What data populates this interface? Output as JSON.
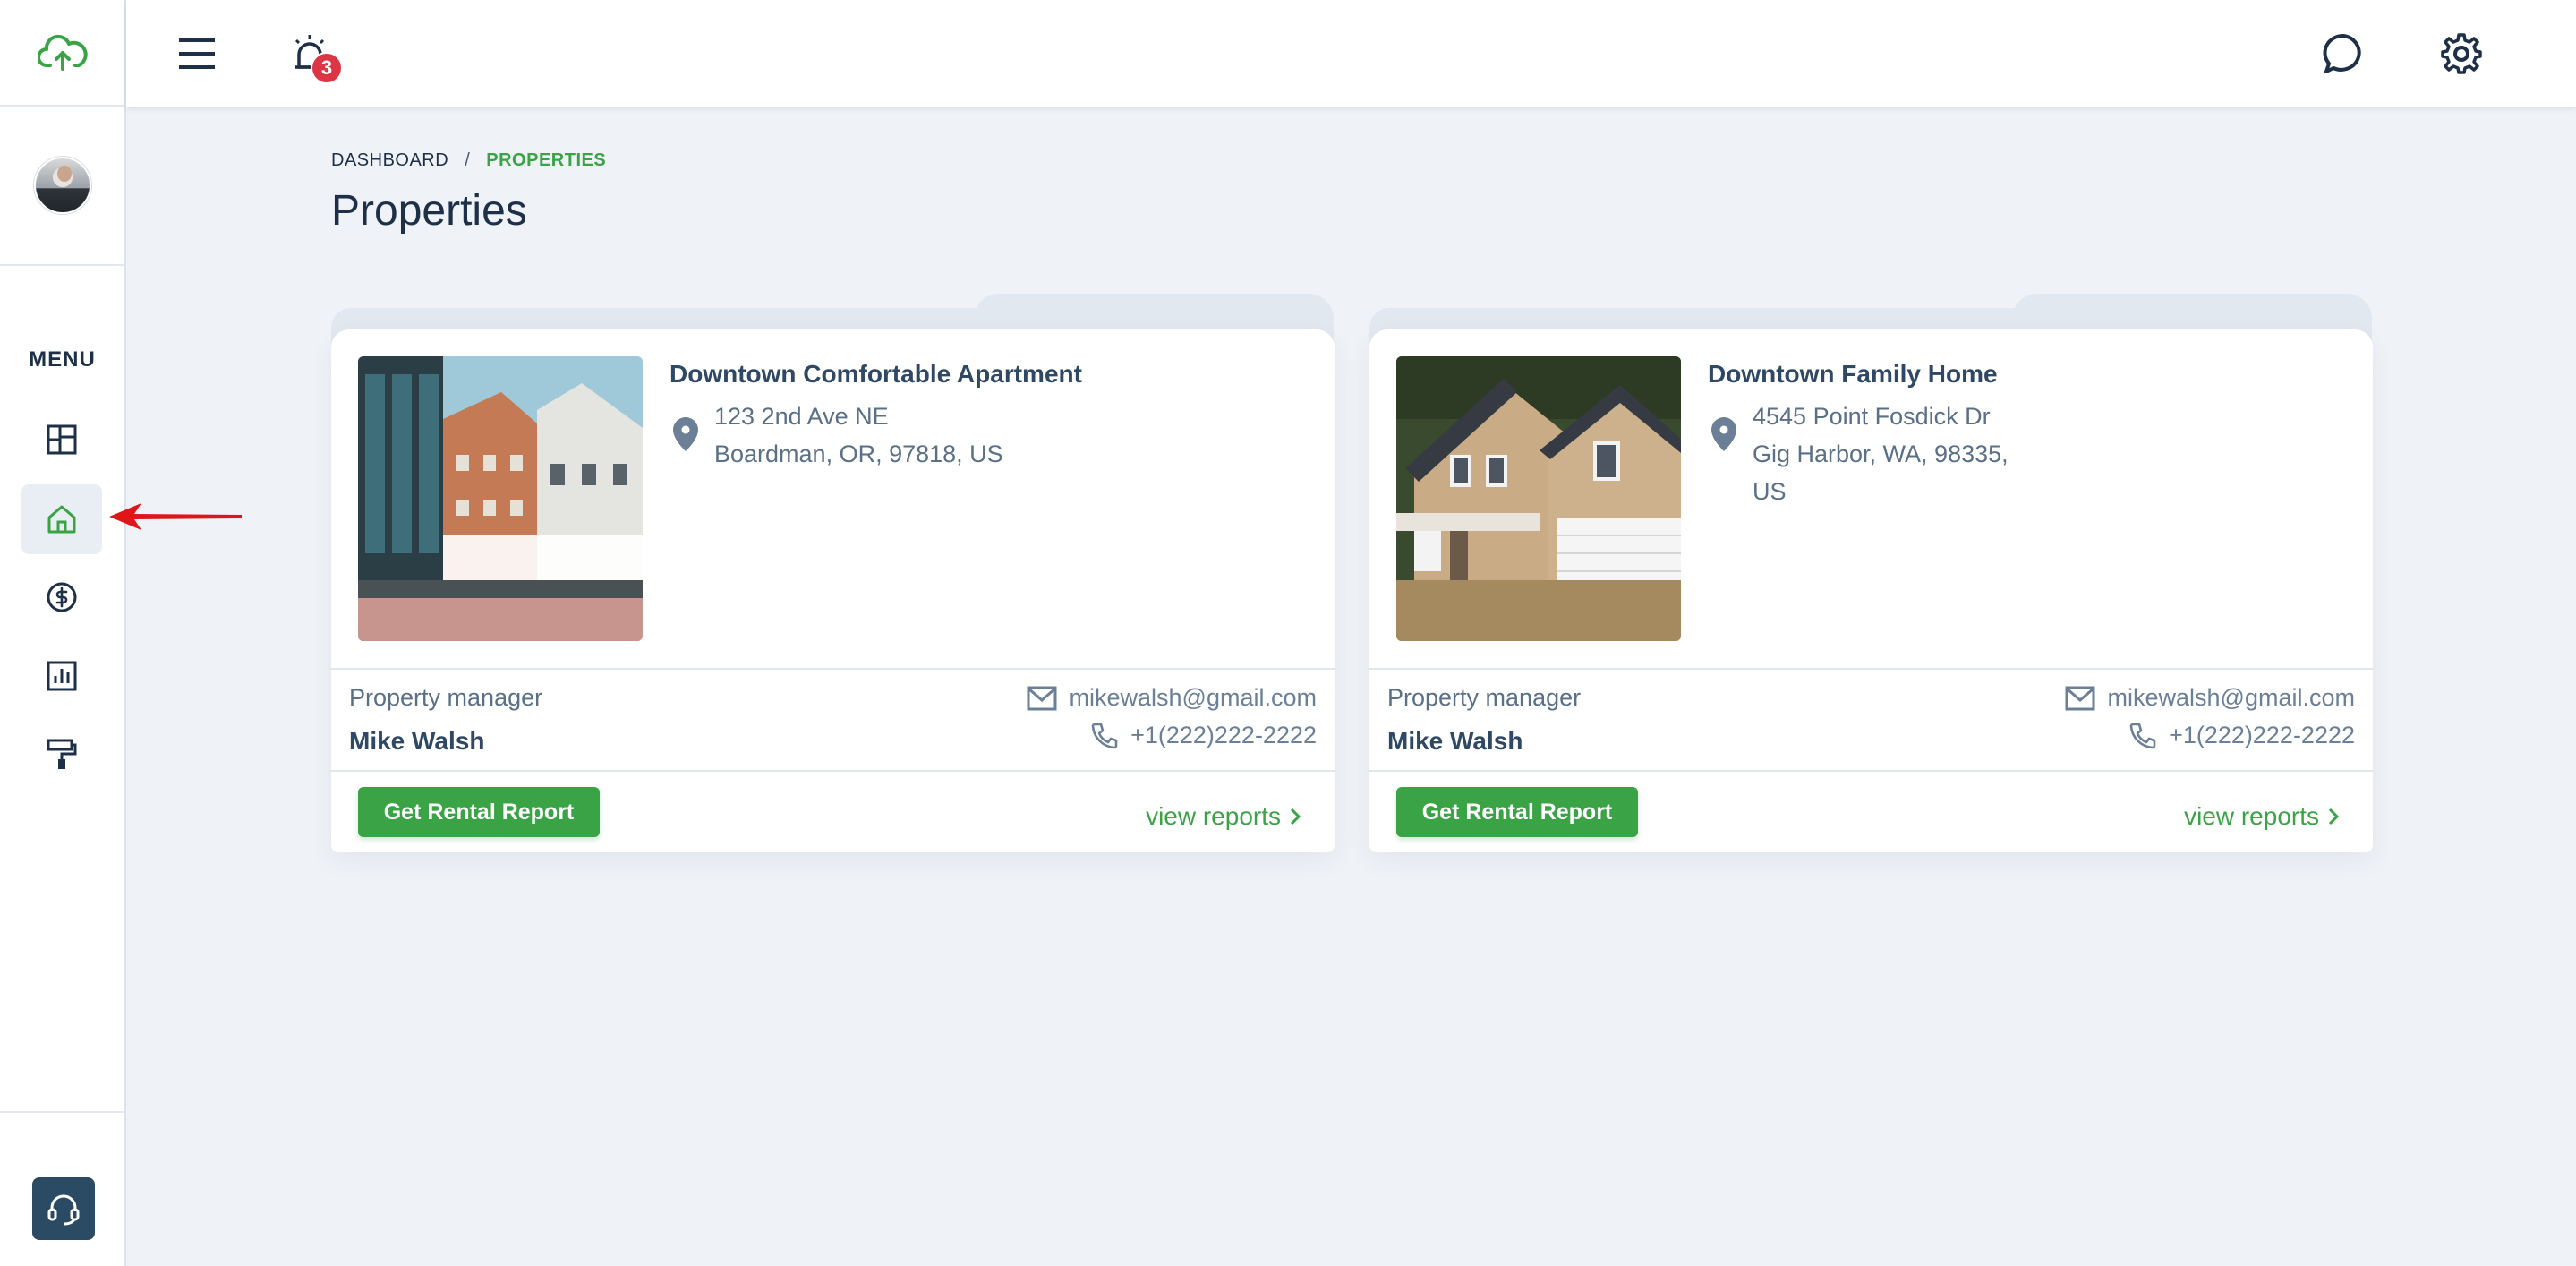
{
  "sidebar": {
    "menu_label": "MENU",
    "items": [
      {
        "icon": "dashboard-icon"
      },
      {
        "icon": "home-icon",
        "active": true
      },
      {
        "icon": "dollar-icon"
      },
      {
        "icon": "chart-icon"
      },
      {
        "icon": "paint-roller-icon"
      }
    ]
  },
  "topbar": {
    "notification_count": "3"
  },
  "breadcrumb": {
    "root": "DASHBOARD",
    "separator": "/",
    "current": "PROPERTIES"
  },
  "page": {
    "title": "Properties"
  },
  "properties": [
    {
      "title": "Downtown Comfortable Apartment",
      "address_line1": "123 2nd Ave NE",
      "address_line2": "Boardman, OR, 97818, US",
      "address_line3": "",
      "manager_label": "Property manager",
      "manager_name": "Mike Walsh",
      "email": "mikewalsh@gmail.com",
      "phone": "+1(222)222-2222",
      "button_label": "Get Rental Report",
      "link_label": "view reports"
    },
    {
      "title": "Downtown Family Home",
      "address_line1": "4545 Point Fosdick Dr",
      "address_line2": "Gig Harbor, WA, 98335,",
      "address_line3": "US",
      "manager_label": "Property manager",
      "manager_name": "Mike Walsh",
      "email": "mikewalsh@gmail.com",
      "phone": "+1(222)222-2222",
      "button_label": "Get Rental Report",
      "link_label": "view reports"
    }
  ],
  "colors": {
    "accent_green": "#3aa345",
    "text_dark": "#1e2f48",
    "badge_red": "#dc3545",
    "support_blue": "#2b4a63"
  }
}
